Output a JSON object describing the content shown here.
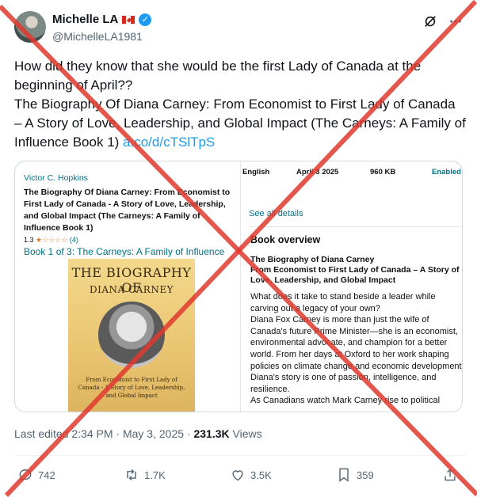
{
  "user": {
    "display_name": "Michelle LA",
    "handle": "@MichelleLA1981"
  },
  "tweet": {
    "text_plain": "How did they know that she would be the first Lady of Canada at the beginning of April??\nThe Biography Of Diana Carney: From Economist to First Lady of Canada – A Story of Love, Leadership, and Global Impact (The Carneys: A Family of Influence Book 1) ",
    "link_text": "a.co/d/cTSlTpS"
  },
  "book_card": {
    "author": "Victor C. Hopkins",
    "title": "The Biography Of Diana Carney: From Economist to First Lady of Canada - A Story of Love, Leadership, and Global Impact (The Carneys: A Family of Influence Book 1)",
    "rating": "1.3",
    "stars": "★☆☆☆☆",
    "rating_count": "(4)",
    "series": "Book 1 of 3: The Carneys: A Family of Influence",
    "cover": {
      "title_line1": "THE BIOGRAPHY OF",
      "title_line2": "DIANA CARNEY",
      "subtitle": "From Economist to First Lady of Canada - A Story of Love, Leadership, and Global Impact"
    },
    "meta": {
      "language": "English",
      "date": "April 3 2025",
      "size": "960 KB",
      "enabled": "Enabled"
    },
    "see_all": "See all details",
    "overview_heading": "Book overview",
    "overview_title": "The Biography of Diana Carney\nFrom Economist to First Lady of Canada – A Story of Love, Leadership, and Global Impact",
    "overview_body": "What does it take to stand beside a leader while carving out a legacy of your own?\nDiana Fox Carney is more than just the wife of Canada's future Prime Minister—she is an economist, environmental advocate, and champion for a better world. From her days at Oxford to her work shaping policies on climate change and economic development, Diana's story is one of passion, intelligence, and resilience.\nAs Canadians watch Mark Carney rise to political"
  },
  "timestamp": {
    "prefix": "Last edited 2:34 PM · May 3, 2025 · ",
    "views_count": "231.3K",
    "views_label": " Views"
  },
  "actions": {
    "replies": "742",
    "reposts": "1.7K",
    "likes": "3.5K",
    "bookmarks": "359"
  },
  "colors": {
    "accent": "#1d9bf0",
    "overlay_cross": "#e03a2f"
  }
}
